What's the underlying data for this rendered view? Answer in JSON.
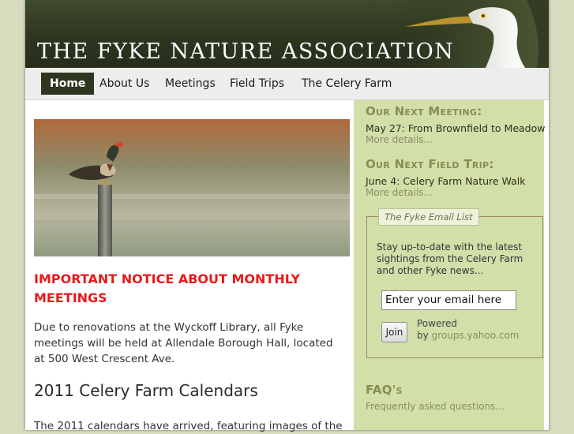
{
  "header": {
    "title": "THE FYKE NATURE ASSOCIATION"
  },
  "nav": {
    "items": [
      {
        "label": "Home",
        "active": true
      },
      {
        "label": "About Us",
        "active": false
      },
      {
        "label": "Meetings",
        "active": false
      },
      {
        "label": "Field Trips",
        "active": false
      },
      {
        "label": "The Celery Farm",
        "active": false
      }
    ]
  },
  "main": {
    "notice_title": "IMPORTANT NOTICE ABOUT MONTHLY MEETINGS",
    "notice_body": "Due to renovations at the Wyckoff Library, all Fyke meetings will be held at Allendale Borough Hall, located at 500 West Crescent Ave.",
    "calendar_title": "2011 Celery Farm Calendars",
    "calendar_body": "The 2011 calendars have arrived, featuring images of the"
  },
  "sidebar": {
    "next_meeting": {
      "heading": "Our Next Meeting:",
      "text": "May 27: From Brownfield to Meadow",
      "more": "More details..."
    },
    "next_trip": {
      "heading": "Our Next Field Trip:",
      "text": "June 4: Celery Farm Nature Walk",
      "more": "More details..."
    },
    "email_list": {
      "legend": "The Fyke Email List",
      "description": "Stay up-to-date with the latest sightings from the Celery Farm and other Fyke news...",
      "input_value": "Enter your email here",
      "join_label": "Join",
      "powered_label": "Powered",
      "by_label": "by",
      "powered_link": "groups.yahoo.com"
    },
    "faq": {
      "heading": "FAQ's",
      "text": "Frequently asked questions..."
    }
  },
  "colors": {
    "header_bg": "#2e3620",
    "notice_red": "#e8191b",
    "sidebar_bg": "#d2dfa9",
    "sidebar_heading": "#8a8d52"
  }
}
